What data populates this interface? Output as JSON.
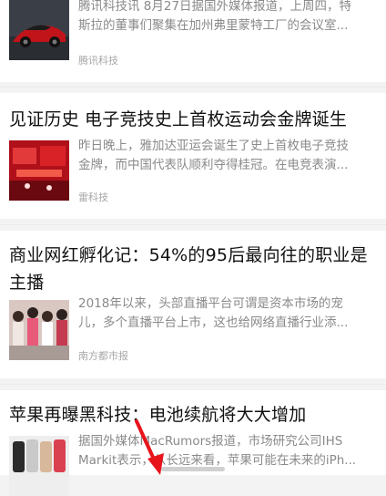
{
  "articles": [
    {
      "title": "",
      "summary_lines": [
        "腾讯科技讯 8月27日据国外媒体报道，上周四，特",
        "斯拉的董事们聚集在加州弗里蒙特工厂的会议室..."
      ],
      "source": "腾讯科技",
      "thumb": "red-sports-car"
    },
    {
      "title": "见证历史 电子竞技史上首枚运动会金牌诞生",
      "summary_lines": [
        "昨日晚上，雅加达亚运会诞生了史上首枚电子竞技",
        "金牌，而中国代表队顺利夺得桂冠。在电竞表演..."
      ],
      "source": "雷科技",
      "thumb": "esports-stage"
    },
    {
      "title_lines": [
        "商业网红孵化记：54%的95后最向往的职业是",
        "主播"
      ],
      "summary_lines": [
        "2018年以来，头部直播平台可谓是资本市场的宠",
        "儿，多个直播平台上市，这也给网络直播行业添..."
      ],
      "source": "南方都市报",
      "thumb": "streamers-group"
    },
    {
      "title": "苹果再曝黑科技：电池续航将大大增加",
      "summary_lines": [
        "据国外媒体MacRumors报道，市场研究公司IHS",
        "Markit表示，从长远来看，苹果可能在未来的iPh..."
      ],
      "source": "",
      "thumb": "iphones-row"
    }
  ],
  "colors": {
    "arrow": "#e8141c",
    "summary": "#8a8a8a",
    "source": "#a6a6a6"
  }
}
